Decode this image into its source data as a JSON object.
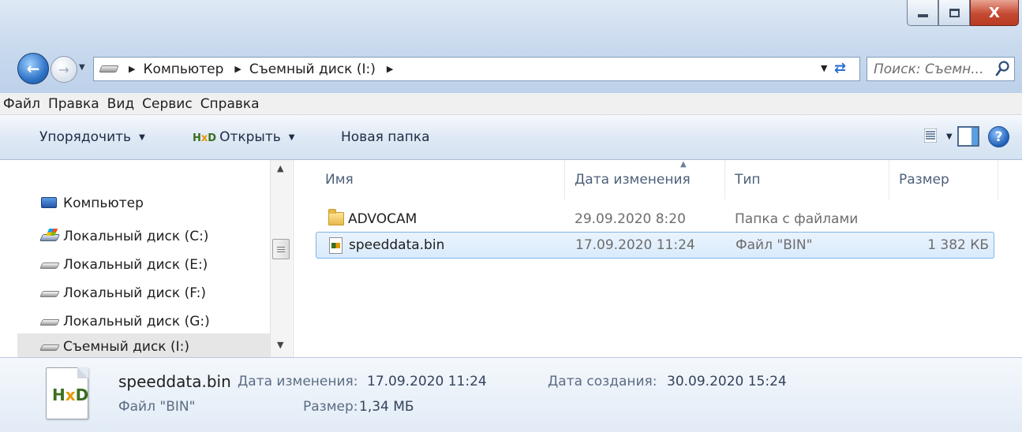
{
  "window": {
    "close_label": "X"
  },
  "address": {
    "crumbs": [
      "Компьютер",
      "Съемный диск (I:)"
    ],
    "search_placeholder": "Поиск: Съемн..."
  },
  "menu": [
    "Файл",
    "Правка",
    "Вид",
    "Сервис",
    "Справка"
  ],
  "toolbar": {
    "organize": "Упорядочить",
    "open": "Открыть",
    "open_logo": "HxD",
    "new_folder": "Новая папка",
    "help": "?"
  },
  "nav": {
    "items": [
      {
        "label": "Компьютер",
        "icon": "computer-icon"
      },
      {
        "label": "Локальный диск (C:)",
        "icon": "system-drive-icon"
      },
      {
        "label": "Локальный диск (E:)",
        "icon": "drive-icon"
      },
      {
        "label": "Локальный диск (F:)",
        "icon": "drive-icon"
      },
      {
        "label": "Локальный диск (G:)",
        "icon": "drive-icon"
      },
      {
        "label": "Съемный диск (I:)",
        "icon": "drive-icon",
        "selected": true
      }
    ]
  },
  "columns": [
    "Имя",
    "Дата изменения",
    "Тип",
    "Размер"
  ],
  "files": [
    {
      "name": "ADVOCAM",
      "date": "29.09.2020 8:20",
      "type": "Папка с файлами",
      "size": "",
      "icon": "folder-icon"
    },
    {
      "name": "speeddata.bin",
      "date": "17.09.2020 11:24",
      "type": "Файл \"BIN\"",
      "size": "1 382 КБ",
      "icon": "bin-file-icon",
      "selected": true
    }
  ],
  "details": {
    "filename": "speeddata.bin",
    "modified_label": "Дата изменения:",
    "modified_value": "17.09.2020 11:24",
    "created_label": "Дата создания:",
    "created_value": "30.09.2020 15:24",
    "type": "Файл \"BIN\"",
    "size_label": "Размер:",
    "size_value": "1,34 МБ",
    "logo": "HxD"
  },
  "colors": {
    "selection_bg": "#d9ebfc",
    "selection_border": "#7eb4ea",
    "header_text": "#4c607a"
  }
}
